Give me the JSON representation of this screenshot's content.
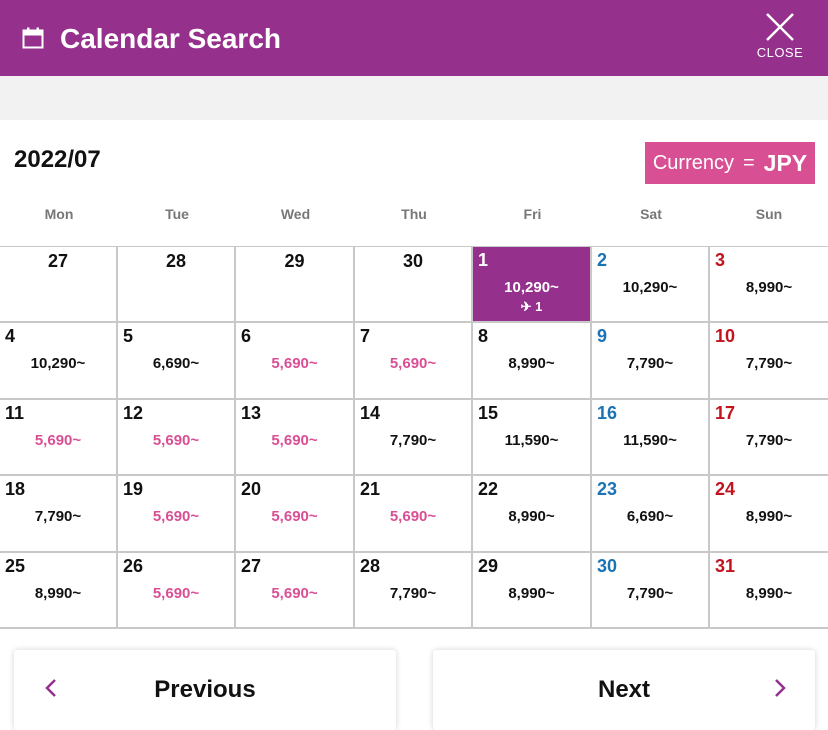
{
  "header": {
    "title": "Calendar Search",
    "close_label": "CLOSE",
    "color": "#96308d"
  },
  "month": "2022/07",
  "currency": {
    "label": "Currency",
    "eq": "=",
    "code": "JPY"
  },
  "weekdays": [
    "Mon",
    "Tue",
    "Wed",
    "Thu",
    "Fri",
    "Sat",
    "Sun"
  ],
  "weeks": [
    [
      {
        "day": "27",
        "prev": true
      },
      {
        "day": "28",
        "prev": true
      },
      {
        "day": "29",
        "prev": true
      },
      {
        "day": "30",
        "prev": true
      },
      {
        "day": "1",
        "price": "10,290~",
        "flights": "✈ 1",
        "selected": true
      },
      {
        "day": "2",
        "price": "10,290~"
      },
      {
        "day": "3",
        "price": "8,990~"
      }
    ],
    [
      {
        "day": "4",
        "price": "10,290~"
      },
      {
        "day": "5",
        "price": "6,690~"
      },
      {
        "day": "6",
        "price": "5,690~",
        "cheap": true
      },
      {
        "day": "7",
        "price": "5,690~",
        "cheap": true
      },
      {
        "day": "8",
        "price": "8,990~"
      },
      {
        "day": "9",
        "price": "7,790~"
      },
      {
        "day": "10",
        "price": "7,790~"
      }
    ],
    [
      {
        "day": "11",
        "price": "5,690~",
        "cheap": true
      },
      {
        "day": "12",
        "price": "5,690~",
        "cheap": true
      },
      {
        "day": "13",
        "price": "5,690~",
        "cheap": true
      },
      {
        "day": "14",
        "price": "7,790~"
      },
      {
        "day": "15",
        "price": "11,590~"
      },
      {
        "day": "16",
        "price": "11,590~"
      },
      {
        "day": "17",
        "price": "7,790~"
      }
    ],
    [
      {
        "day": "18",
        "price": "7,790~"
      },
      {
        "day": "19",
        "price": "5,690~",
        "cheap": true
      },
      {
        "day": "20",
        "price": "5,690~",
        "cheap": true
      },
      {
        "day": "21",
        "price": "5,690~",
        "cheap": true
      },
      {
        "day": "22",
        "price": "8,990~"
      },
      {
        "day": "23",
        "price": "6,690~"
      },
      {
        "day": "24",
        "price": "8,990~"
      }
    ],
    [
      {
        "day": "25",
        "price": "8,990~"
      },
      {
        "day": "26",
        "price": "5,690~",
        "cheap": true
      },
      {
        "day": "27",
        "price": "5,690~",
        "cheap": true
      },
      {
        "day": "28",
        "price": "7,790~"
      },
      {
        "day": "29",
        "price": "8,990~"
      },
      {
        "day": "30",
        "price": "7,790~"
      },
      {
        "day": "31",
        "price": "8,990~"
      }
    ]
  ],
  "nav": {
    "previous": "Previous",
    "next": "Next"
  },
  "colors": {
    "cheap": "#d94f94",
    "saturday": "#1a73b5",
    "sunday": "#c4121f",
    "selected": "#96308d"
  },
  "icons": {
    "header": "calendar-icon",
    "close": "close-icon",
    "flight": "airplane-icon",
    "prev": "chevron-left-icon",
    "next": "chevron-right-icon"
  }
}
